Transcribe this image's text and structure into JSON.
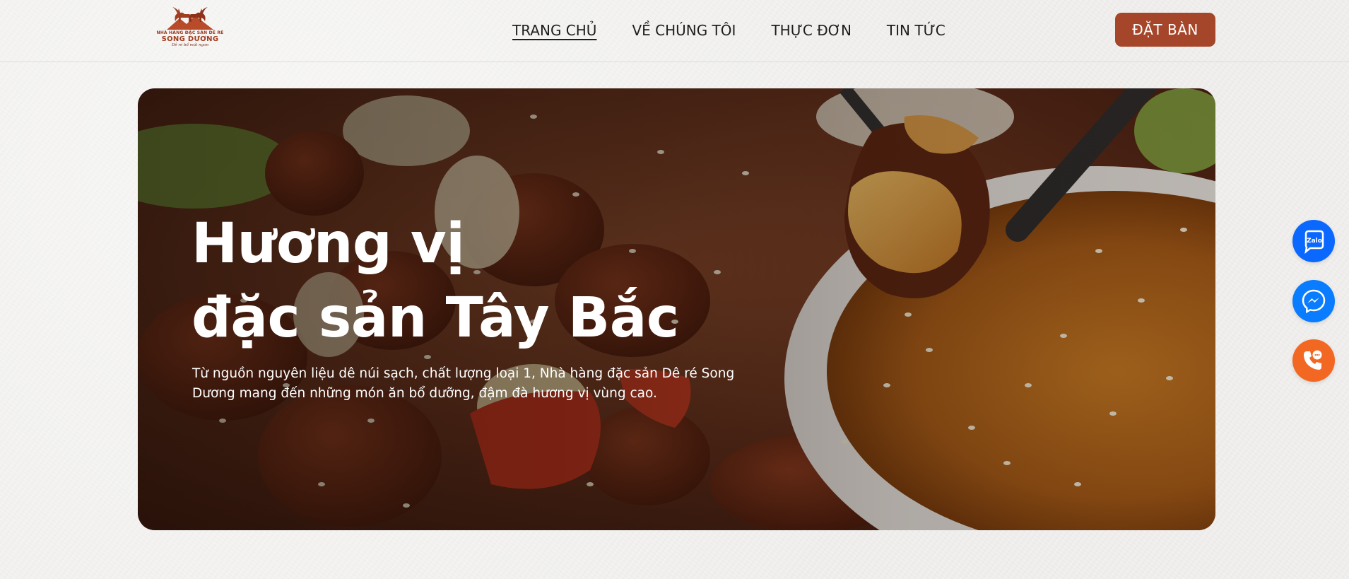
{
  "brand": {
    "top_line": "NHÀ HÀNG ĐẶC SẢN DÊ RÉ",
    "name": "SONG DƯƠNG",
    "slogan": "Dê ré bổ mát ngon",
    "color": "#a5462b"
  },
  "nav": {
    "items": [
      {
        "label": "TRANG CHỦ",
        "active": true
      },
      {
        "label": "VỀ CHÚNG TÔI",
        "active": false
      },
      {
        "label": "THỰC ĐƠN",
        "active": false
      },
      {
        "label": "TIN TỨC",
        "active": false
      }
    ]
  },
  "header": {
    "book_button": "ĐẶT BÀN"
  },
  "hero": {
    "title_line1": "Hương vị",
    "title_line2": "đặc sản Tây Bắc",
    "description": "Từ nguồn nguyên liệu dê núi sạch, chất lượng loại 1, Nhà hàng đặc sản Dê ré Song Dương mang đến những món ăn bổ dưỡng, đậm đà hương vị vùng cao."
  },
  "floating": {
    "zalo_label": "Zalo",
    "zalo_color": "#0b68ff",
    "messenger_color": "#0a7cff",
    "phone_color": "#f26822",
    "icons": [
      "zalo-icon",
      "messenger-icon",
      "phone-icon"
    ]
  }
}
